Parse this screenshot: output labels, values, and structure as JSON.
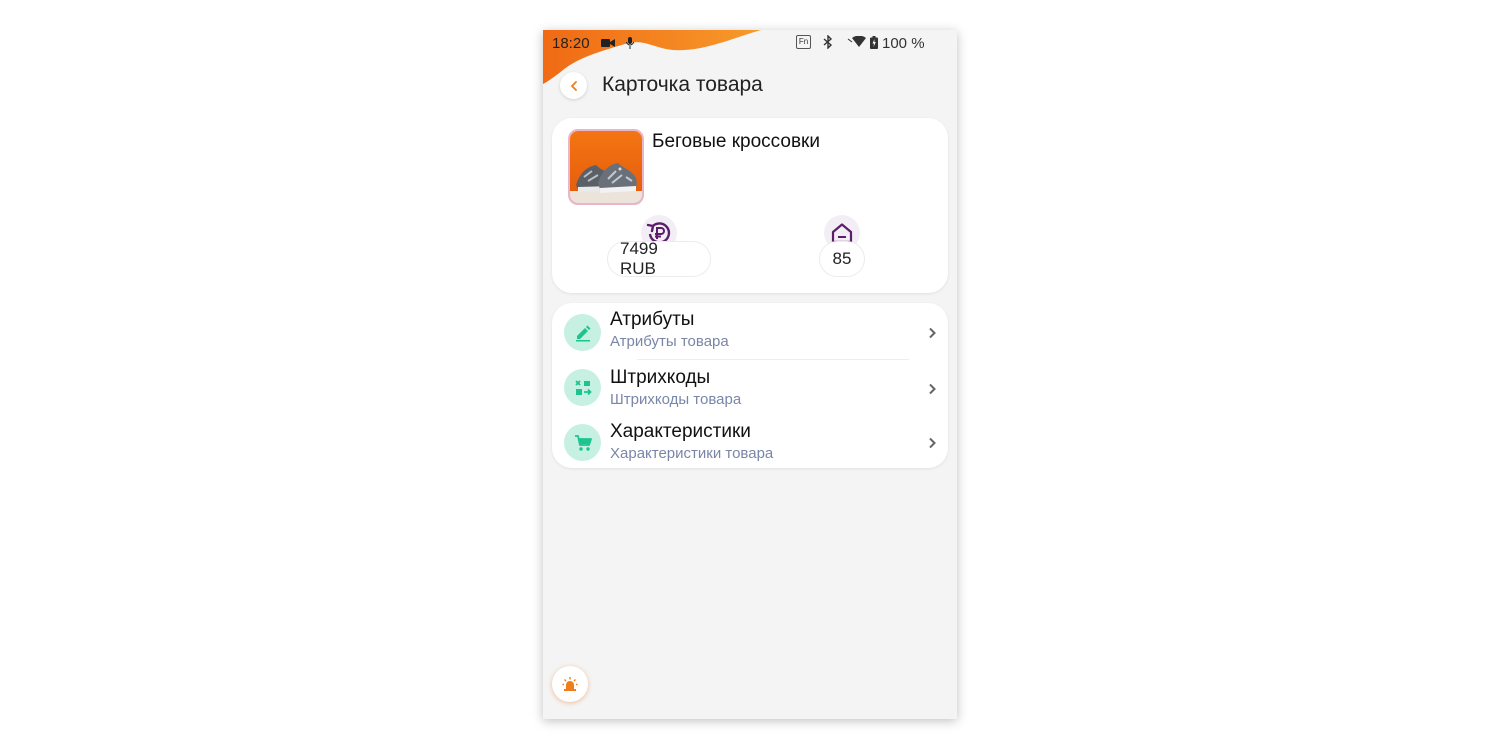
{
  "status_bar": {
    "time": "18:20",
    "battery": "100 %",
    "fn_label": "Fn",
    "icons": [
      "video-record-icon",
      "mic-icon",
      "bluetooth-icon",
      "wifi-icon",
      "battery-icon"
    ]
  },
  "header": {
    "title": "Карточка товара",
    "back_icon": "chevron-left-icon"
  },
  "product": {
    "name": "Беговые кроссовки",
    "image": "running-shoes-photo",
    "price": "7499 RUB",
    "price_icon": "ruble-refresh-icon",
    "stock": "85",
    "stock_icon": "home-icon"
  },
  "menu": {
    "items": [
      {
        "title": "Атрибуты",
        "subtitle": "Атрибуты товара",
        "icon": "pencil-icon"
      },
      {
        "title": "Штрихкоды",
        "subtitle": "Штрихкоды товара",
        "icon": "barcode-scan-icon"
      },
      {
        "title": "Характеристики",
        "subtitle": "Характеристики товара",
        "icon": "cart-icon"
      }
    ]
  },
  "colors": {
    "accent_orange": "#f07d18",
    "icon_purple": "#5a1e6b",
    "menu_icon_bg": "#c6f0e2",
    "menu_icon_fg": "#1ec48e",
    "subtitle": "#7a86a8"
  },
  "fab": {
    "icon": "alarm-light-icon"
  }
}
